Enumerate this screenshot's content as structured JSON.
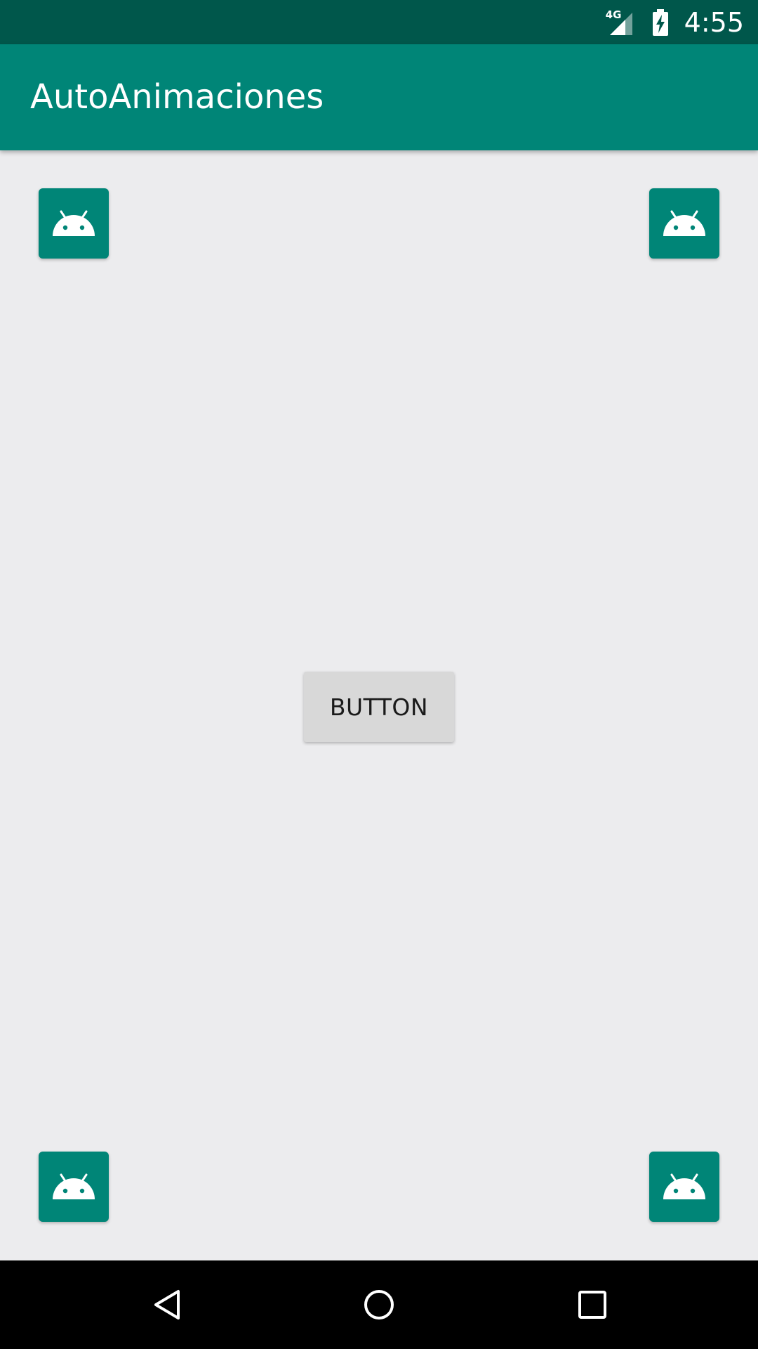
{
  "status_bar": {
    "network_label": "4G",
    "time": "4:55",
    "icons": [
      "signal-icon",
      "battery-charging-icon"
    ]
  },
  "app_bar": {
    "title": "AutoAnimaciones"
  },
  "content": {
    "button_label": "BUTTON",
    "corner_icons": [
      "android-launcher-icon",
      "android-launcher-icon",
      "android-launcher-icon",
      "android-launcher-icon"
    ]
  },
  "nav_bar": {
    "icons": [
      "back-icon",
      "home-icon",
      "recents-icon"
    ]
  },
  "colors": {
    "status_bar": "#00574b",
    "app_bar": "#008577",
    "background": "#ececee",
    "button": "#d8d8d8",
    "nav_bar": "#000000"
  }
}
